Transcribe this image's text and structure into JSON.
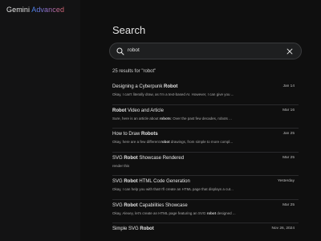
{
  "app": {
    "name": "Gemini",
    "tier": "Advanced"
  },
  "page": {
    "title": "Search"
  },
  "search": {
    "query": "robot",
    "icon": "search-icon",
    "clear_icon": "close-icon"
  },
  "results_count_text": "25 results for \"robot\"",
  "results": [
    {
      "title_pre": "Designing a Cyberpunk ",
      "title_bold": "Robot",
      "title_post": "",
      "snippet_pre": "Okay, I can't literally draw, as I'm a text-based AI. However, I can give you ...",
      "snippet_bold": "",
      "snippet_post": "",
      "date": "Jan 14"
    },
    {
      "title_pre": "",
      "title_bold": "Robot",
      "title_post": " Video and Article",
      "snippet_pre": "Sure, here is an article about ",
      "snippet_bold": "robots",
      "snippet_post": ": Over the past few decades, robots ...",
      "date": "Mar 16"
    },
    {
      "title_pre": "How to Draw ",
      "title_bold": "Robots",
      "title_post": "",
      "snippet_pre": "Okay, here are a few different ",
      "snippet_bold": "robot",
      "snippet_post": " drawings, from simple to more compl...",
      "date": "Jan 25"
    },
    {
      "title_pre": "SVG ",
      "title_bold": "Robot",
      "title_post": " Showcase Rendered",
      "snippet_pre": "render this",
      "snippet_bold": "",
      "snippet_post": "",
      "date": "Mar 25"
    },
    {
      "title_pre": "SVG ",
      "title_bold": "Robot",
      "title_post": " HTML Code Generation",
      "snippet_pre": "Okay, I can help you with that! I'll create an HTML page that displays a cut...",
      "snippet_bold": "",
      "snippet_post": "",
      "date": "Yesterday"
    },
    {
      "title_pre": "SVG ",
      "title_bold": "Robot",
      "title_post": " Capabilities Showcase",
      "snippet_pre": "Okay, Alexey, let's create an HTML page featuring an SVG ",
      "snippet_bold": "robot",
      "snippet_post": " designed ...",
      "date": "Mar 25"
    },
    {
      "title_pre": "Simple SVG ",
      "title_bold": "Robot",
      "title_post": "",
      "snippet_pre": "",
      "snippet_bold": "",
      "snippet_post": "",
      "date": "Nov 26, 2024"
    }
  ],
  "colors": {
    "background": "#0f0f0f",
    "sidebar": "#131314",
    "search_box": "#1e1f20",
    "text": "#e3e3e3"
  }
}
